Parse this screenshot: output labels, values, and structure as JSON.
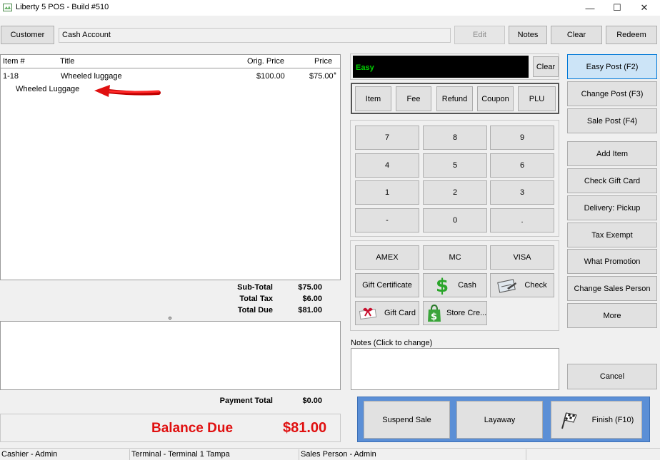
{
  "window": {
    "title": "Liberty 5 POS - Build #510",
    "minimize": "—",
    "maximize": "☐",
    "close": "✕"
  },
  "top": {
    "customer_label": "Customer",
    "account_value": "Cash Account",
    "edit_label": "Edit",
    "notes_label": "Notes",
    "clear_label": "Clear",
    "redeem_label": "Redeem"
  },
  "grid": {
    "headers": {
      "item": "Item #",
      "title": "Title",
      "orig_price": "Orig. Price",
      "price": "Price"
    },
    "rows": [
      {
        "item": "1-18",
        "title": "Wheeled luggage",
        "orig_price": "$100.00",
        "price": "$75.00",
        "flag": "*",
        "subtitle": "Wheeled Luggage"
      }
    ]
  },
  "totals": {
    "subtotal_label": "Sub-Total",
    "subtotal_value": "$75.00",
    "tax_label": "Total Tax",
    "tax_value": "$6.00",
    "due_label": "Total Due",
    "due_value": "$81.00",
    "payment_label": "Payment Total",
    "payment_value": "$0.00",
    "balance_label": "Balance Due",
    "balance_value": "$81.00"
  },
  "entry": {
    "display_value": "Easy",
    "clear_label": "Clear"
  },
  "modes": [
    "Item",
    "Fee",
    "Refund",
    "Coupon",
    "PLU"
  ],
  "keypad": [
    "7",
    "8",
    "9",
    "4",
    "5",
    "6",
    "1",
    "2",
    "3",
    "-",
    "0",
    "."
  ],
  "tenders": {
    "amex": "AMEX",
    "mc": "MC",
    "visa": "VISA",
    "gift_certificate": "Gift Certificate",
    "cash": "Cash",
    "check": "Check",
    "gift_card": "Gift Card",
    "store_credit": "Store Cre..."
  },
  "notes": {
    "label": "Notes (Click to change)"
  },
  "side": {
    "easy_post": "Easy Post (F2)",
    "change_post": "Change Post (F3)",
    "sale_post": "Sale Post (F4)",
    "add_item": "Add Item",
    "check_gift_card": "Check Gift Card",
    "delivery": "Delivery: Pickup",
    "tax_exempt": "Tax Exempt",
    "what_promotion": "What Promotion",
    "change_sales_person": "Change Sales Person",
    "more": "More",
    "cancel": "Cancel"
  },
  "bottom": {
    "suspend": "Suspend Sale",
    "layaway": "Layaway",
    "finish": "Finish (F10)"
  },
  "status": {
    "cashier": "Cashier - Admin",
    "terminal": "Terminal - Terminal 1 Tampa",
    "sales_person": "Sales Person - Admin"
  },
  "colors": {
    "balance": "#e01010",
    "display_text": "#00d000",
    "highlight": "#cce4f7",
    "bottom_bar": "#5b8fd6"
  },
  "icons": [
    "app-icon",
    "arrow-icon",
    "cash-icon",
    "check-icon",
    "gift-card-icon",
    "store-credit-icon",
    "checkered-flag-icon"
  ]
}
